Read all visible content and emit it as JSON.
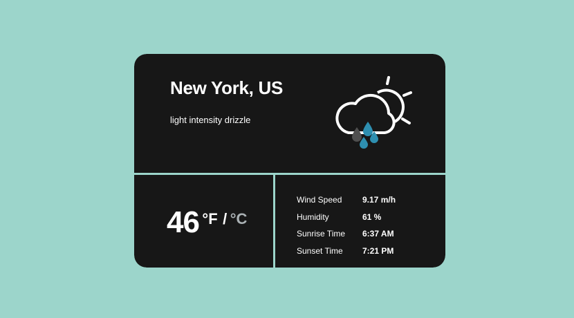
{
  "location": {
    "city": "New York, US",
    "description": "light intensity drizzle"
  },
  "weather_icon": "cloud-sun-drizzle-icon",
  "temperature": {
    "value": "46",
    "unit_f": "°F",
    "separator": "/",
    "unit_c": "°C",
    "active_unit": "F"
  },
  "details": [
    {
      "label": "Wind Speed",
      "value": "9.17 m/h"
    },
    {
      "label": "Humidity",
      "value": "61 %"
    },
    {
      "label": "Sunrise Time",
      "value": "6:37 AM"
    },
    {
      "label": "Sunset Time",
      "value": "7:21 PM"
    }
  ],
  "colors": {
    "background": "#9cd5cb",
    "card": "#171717",
    "text": "#ffffff",
    "inactive_unit": "#aab1b4",
    "drop_dark": "#4f4f4f",
    "drop_blue": "#2e8fb0"
  }
}
